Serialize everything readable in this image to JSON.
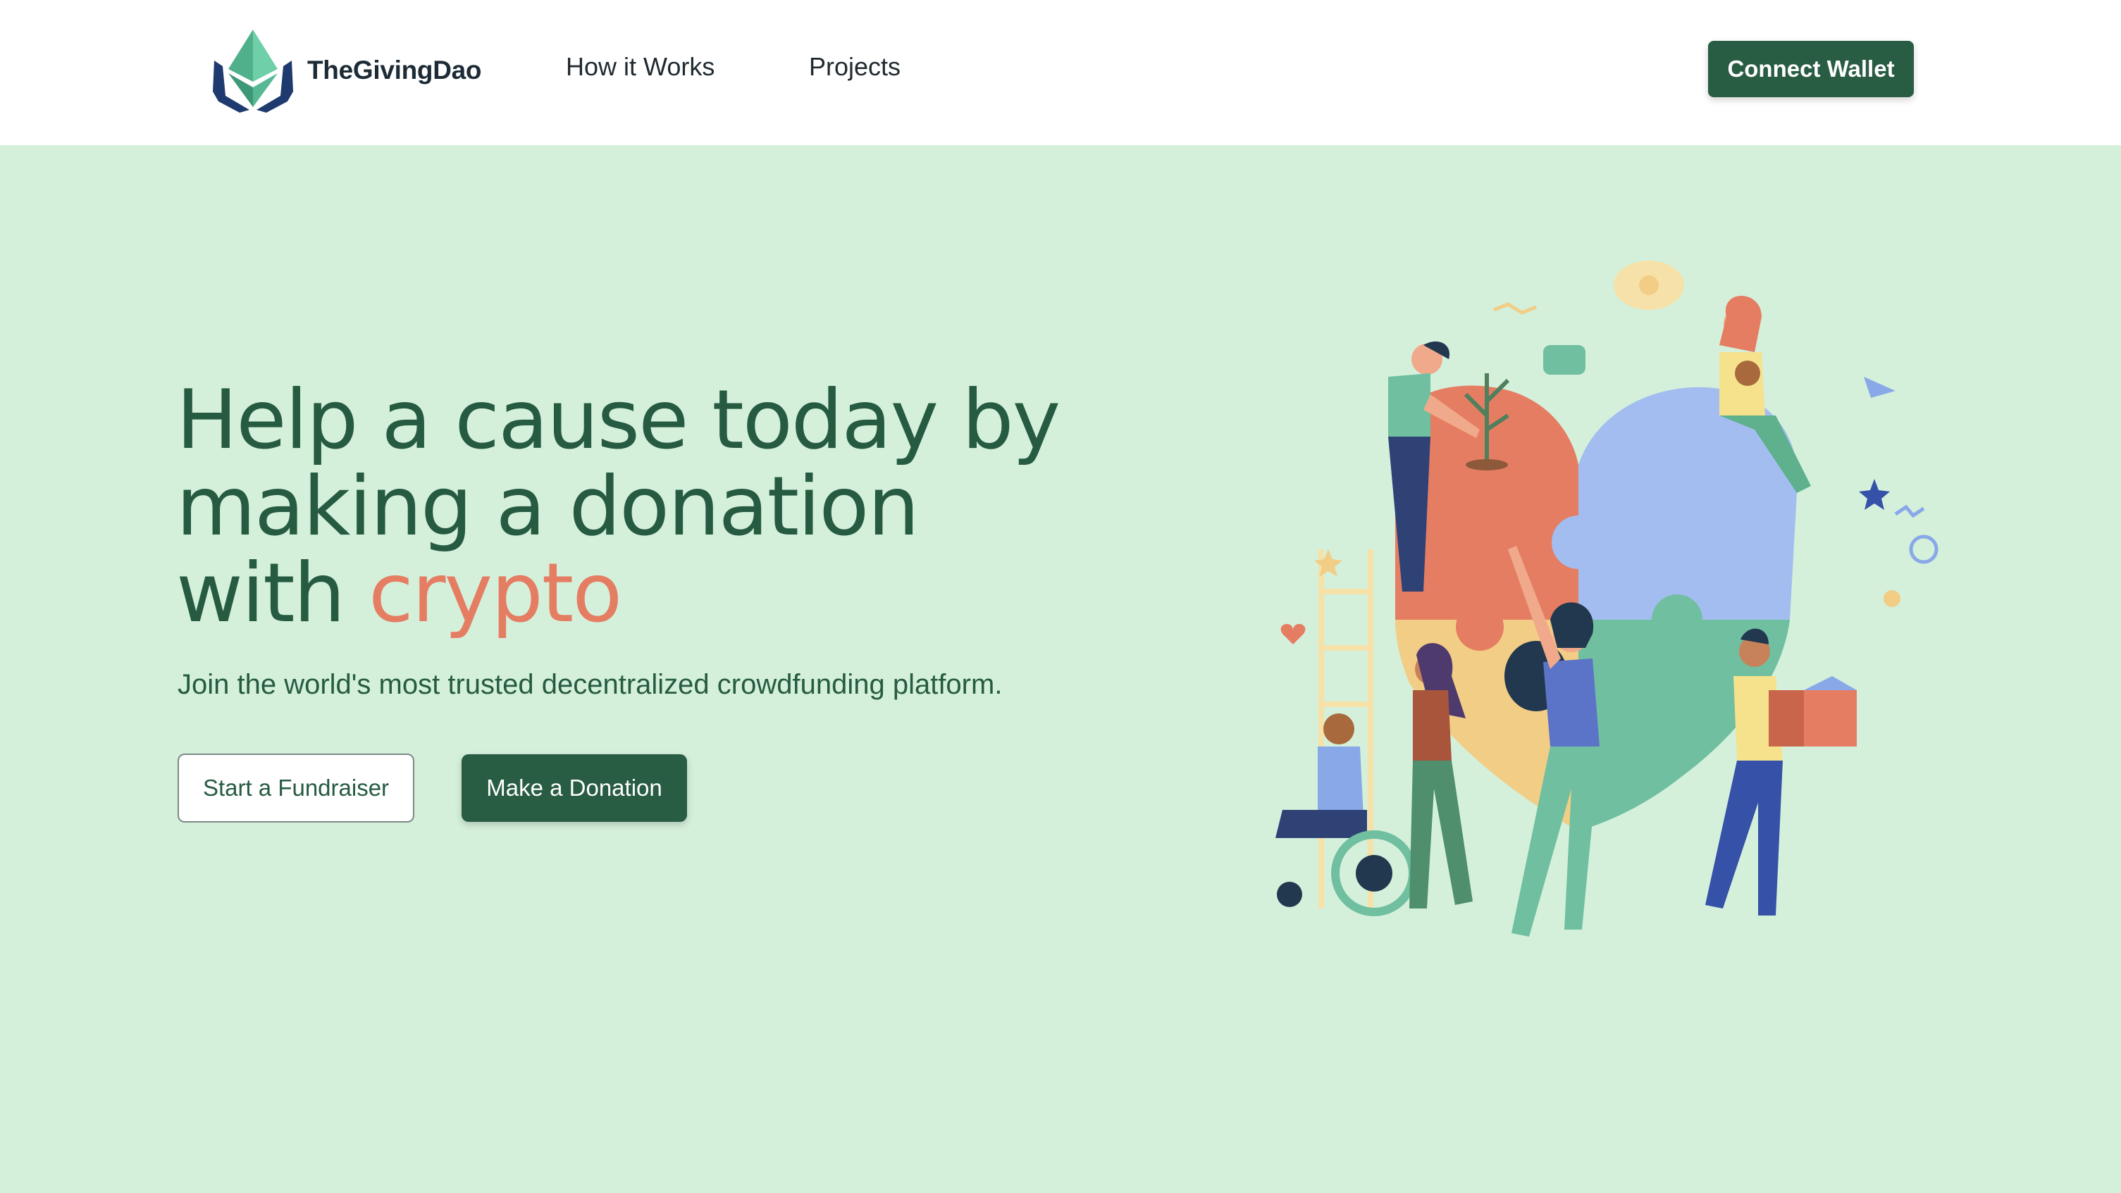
{
  "brand": {
    "name": "TheGivingDao",
    "logo_icon": "ethereum-hands-logo"
  },
  "nav": {
    "links": [
      {
        "label": "How it Works"
      },
      {
        "label": "Projects"
      }
    ],
    "connect_label": "Connect Wallet"
  },
  "hero": {
    "title_main": "Help a cause today by making a donation with",
    "title_accent": "crypto",
    "subtitle": "Join the world's most trusted decentralized crowdfunding platform.",
    "primary_button": "Make a Donation",
    "secondary_button": "Start a Fundraiser",
    "illustration_icon": "people-puzzle-heart-illustration"
  },
  "colors": {
    "page_background": "#d4f0db",
    "brand_green": "#285c43",
    "accent_orange": "#e57d62",
    "puzzle_blue": "#a3bdf0",
    "puzzle_teal": "#6fbfa0",
    "puzzle_yellow": "#f2cd86",
    "puzzle_orange": "#e57d62"
  }
}
